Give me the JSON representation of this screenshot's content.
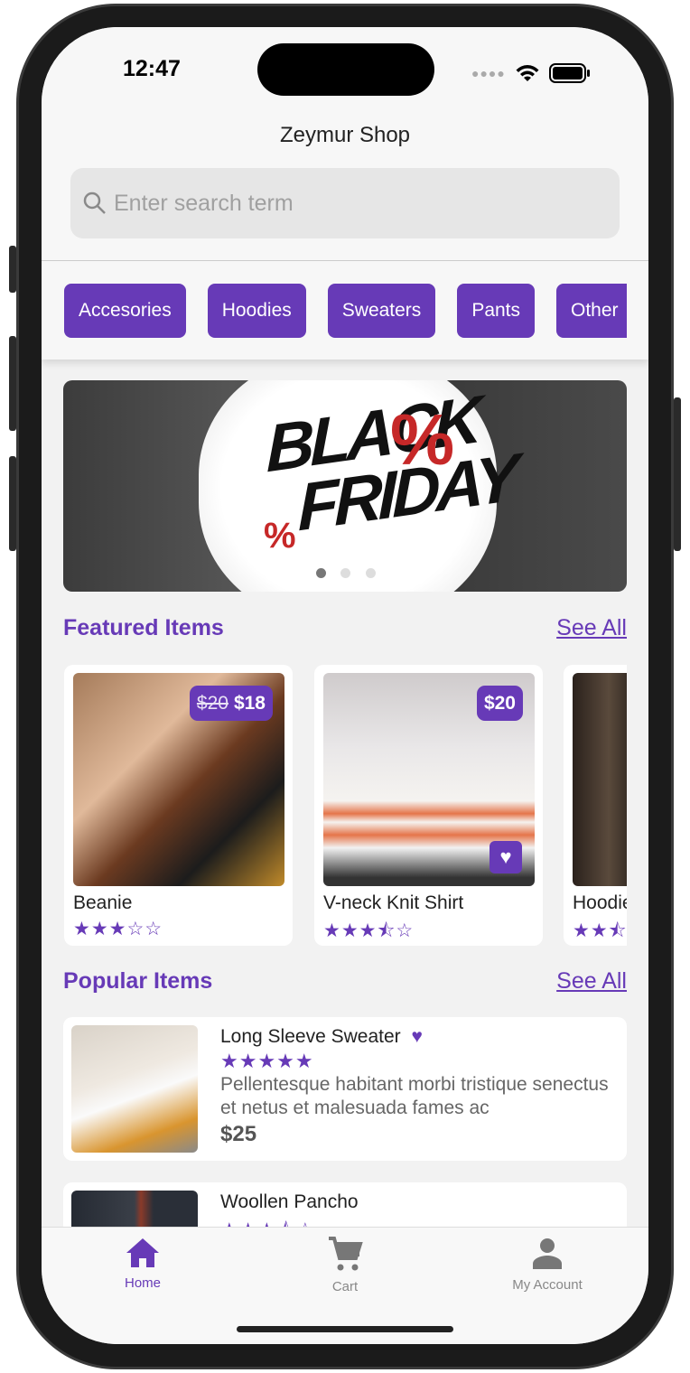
{
  "status": {
    "time": "12:47"
  },
  "header": {
    "title": "Zeymur Shop",
    "search_placeholder": "Enter search term"
  },
  "categories": [
    "Accesories",
    "Hoodies",
    "Sweaters",
    "Pants",
    "Other"
  ],
  "banner": {
    "text_line1": "BLACK",
    "text_line2": "FRIDAY",
    "slides": 3,
    "active_slide": 0
  },
  "featured": {
    "title": "Featured Items",
    "see_all": "See All",
    "items": [
      {
        "name": "Beanie",
        "old_price": "$20",
        "price": "$18",
        "rating": 3,
        "stars": "★★★☆☆",
        "favorite": false
      },
      {
        "name": "V-neck Knit Shirt",
        "price": "$20",
        "rating": 3.5,
        "stars": "★★★⯪☆",
        "favorite": true
      },
      {
        "name": "Hoodie",
        "rating": 2.5,
        "stars": "★★⯪",
        "favorite": false
      }
    ]
  },
  "popular": {
    "title": "Popular Items",
    "see_all": "See All",
    "items": [
      {
        "name": "Long Sleeve Sweater",
        "rating": 5,
        "stars": "★★★★★",
        "description": "Pellentesque habitant morbi tristique senectus et netus et malesuada fames ac",
        "price": "$25",
        "favorite": true
      },
      {
        "name": "Woollen Pancho",
        "rating": 3.5,
        "stars": "★★★⯪☆"
      }
    ]
  },
  "tabbar": {
    "items": [
      {
        "label": "Home",
        "icon": "home-icon",
        "active": true
      },
      {
        "label": "Cart",
        "icon": "cart-icon"
      },
      {
        "label": "My Account",
        "icon": "account-icon"
      }
    ]
  },
  "colors": {
    "accent": "#673ab7",
    "background": "#f2f2f2"
  }
}
